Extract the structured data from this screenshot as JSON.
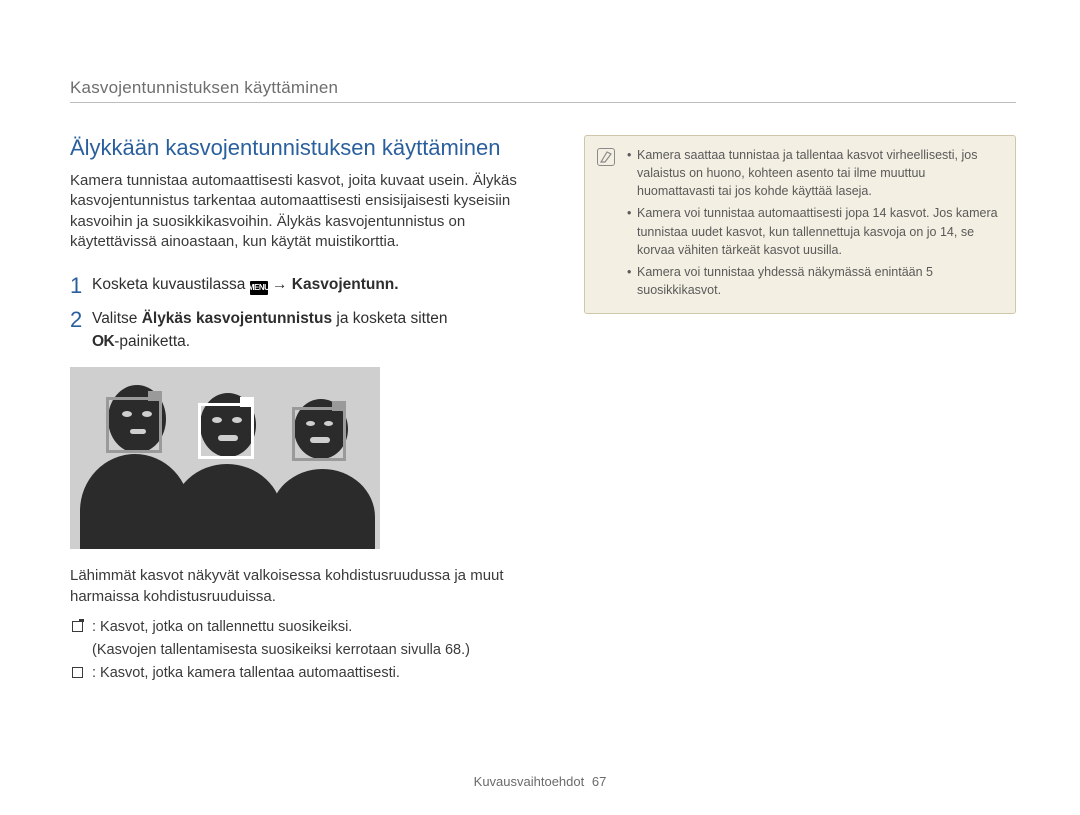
{
  "section_header": "Kasvojentunnistuksen käyttäminen",
  "title": "Älykkään kasvojentunnistuksen käyttäminen",
  "intro": "Kamera tunnistaa automaattisesti kasvot, joita kuvaat usein. Älykäs kasvojentunnistus tarkentaa automaattisesti ensisijaisesti kyseisiin kasvoihin ja suosikkikasvoihin. Älykäs kasvojentunnistus on käytettävissä ainoastaan, kun käytät muistikorttia.",
  "step1_pre": "Kosketa kuvaustilassa ",
  "step1_menu": "MENU",
  "step1_arrow": " → ",
  "step1_bold": "Kasvojentunn.",
  "step2_pre": "Valitse ",
  "step2_bold": "Älykäs kasvojentunnistus",
  "step2_post": " ja kosketa sitten",
  "step2_ok": "OK",
  "step2_ok_post": "-painiketta.",
  "caption": "Lähimmät kasvot näkyvät valkoisessa kohdistusruudussa ja muut harmaissa kohdistusruuduissa.",
  "bullet1": ": Kasvot, jotka on tallennettu suosikeiksi.",
  "bullet1_sub": "(Kasvojen tallentamisesta suosikeiksi kerrotaan sivulla 68.)",
  "bullet2": ": Kasvot, jotka kamera tallentaa automaattisesti.",
  "note1": "Kamera saattaa tunnistaa ja tallentaa kasvot virheellisesti, jos valaistus on huono, kohteen asento tai ilme muuttuu huomattavasti tai jos kohde käyttää laseja.",
  "note2": "Kamera voi tunnistaa automaattisesti jopa 14 kasvot. Jos kamera tunnistaa uudet kasvot, kun tallennettuja kasvoja on jo 14, se korvaa vähiten tärkeät kasvot uusilla.",
  "note3": "Kamera voi tunnistaa yhdessä näkymässä enintään 5 suosikkikasvot.",
  "footer_label": "Kuvausvaihtoehdot",
  "footer_page": "67"
}
